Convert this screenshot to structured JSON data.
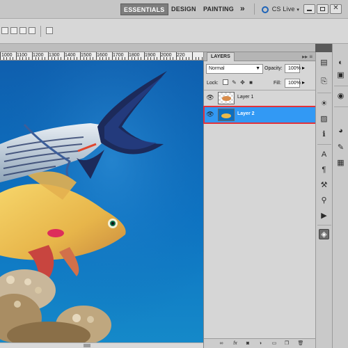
{
  "workspace": {
    "tabs": [
      {
        "label": "ESSENTIALS",
        "active": true
      },
      {
        "label": "DESIGN",
        "active": false
      },
      {
        "label": "PAINTING",
        "active": false
      }
    ],
    "overflow_label": "»",
    "cs_live_label": "CS Live"
  },
  "ruler": {
    "labels": [
      "1000",
      "1100",
      "1200",
      "1300",
      "1400",
      "1500",
      "1600",
      "1700",
      "1800",
      "1900",
      "2000",
      "220"
    ]
  },
  "layers_panel": {
    "tab_label": "LAYERS",
    "blend_mode": "Normal",
    "opacity_label": "Opacity:",
    "opacity_value": "100%",
    "lock_label": "Lock:",
    "fill_label": "Fill:",
    "fill_value": "100%",
    "layers": [
      {
        "name": "Layer 1",
        "visible": true,
        "selected": false
      },
      {
        "name": "Layer 2",
        "visible": true,
        "selected": true
      }
    ],
    "footer_icons": [
      "link-icon",
      "fx-icon",
      "mask-icon",
      "adjustment-icon",
      "folder-icon",
      "new-layer-icon",
      "trash-icon"
    ]
  },
  "colors": {
    "selection_blue": "#3299f4",
    "highlight_red": "#e3323a",
    "water_blue": "#0b66b8"
  }
}
